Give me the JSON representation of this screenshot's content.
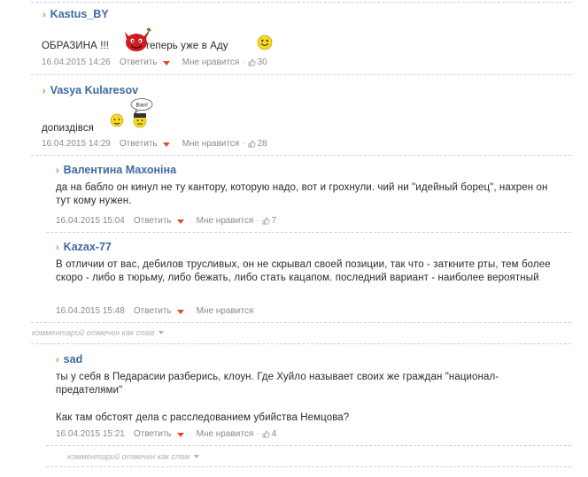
{
  "labels": {
    "reply": "Ответить",
    "like": "Мне нравится",
    "dot": "·",
    "collapsed_note": "комментарий отмечен как спам"
  },
  "comments": [
    {
      "author": "Kastus_BY",
      "text_a": "ОБРАЗИНА !!!",
      "text_b": "теперь уже в Аду",
      "date": "16.04.2015 14:26",
      "likes": "30"
    },
    {
      "author": "Vasya Kularesov",
      "text": "допиздівся",
      "emoji_bubble": "Ban!",
      "date": "16.04.2015 14:29",
      "likes": "28"
    },
    {
      "author": "Валентина Махоніна",
      "text": "да на бабло он кинул не ту кантору, которую надо, вот и грохнули. чий ни \"идейный борец\", нахрен он тут кому нужен.",
      "date": "16.04.2015 15:04",
      "likes": "7"
    },
    {
      "author": "Kazax-77",
      "text": "В отличии от вас, дебилов трусливых, он не скрывал своей позиции, так что - заткните рты, тем более скоро - либо в тюрьму, либо бежать, либо стать кацапом. последний вариант - наиболее вероятный",
      "date": "16.04.2015 15:48",
      "likes": ""
    },
    {
      "author": "sad",
      "text": "ты у себя в Педарасии разберись, клоун. Где Хуйло называет своих же граждан \"национал-предателями\"",
      "text2": "Как там обстоят дела с расследованием убийства Немцова?",
      "date": "16.04.2015 15:21",
      "likes": "4"
    }
  ],
  "colors": {
    "author": "#3e6aa0",
    "chevron": "#e67e22",
    "caret": "#e04a2a",
    "meta": "#8a8a8a",
    "separator": "#d0d0d0"
  },
  "icons": [
    "thumbs-up-icon",
    "devil-emoji-icon",
    "smiley-emoji-icon",
    "ban-emoji-icon",
    "chevron-right-icon",
    "caret-down-icon"
  ]
}
